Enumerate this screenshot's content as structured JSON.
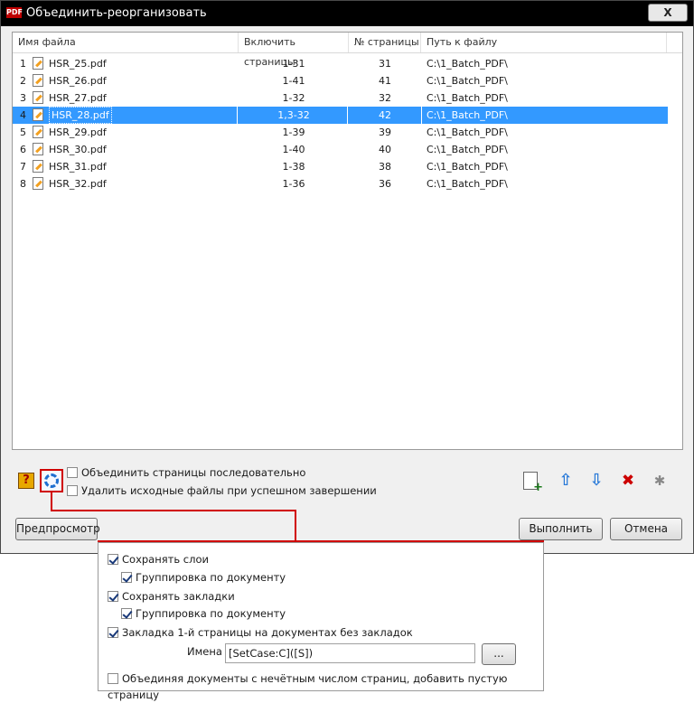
{
  "window": {
    "title": "Объединить-реорганизовать",
    "close_label": "X"
  },
  "columns": [
    "Имя файла",
    "Включить страницы",
    "№ страницы",
    "Путь к файлу"
  ],
  "rows": [
    {
      "num": "1",
      "name": "HSR_25.pdf",
      "include": "1-31",
      "pages": "31",
      "path": "C:\\1_Batch_PDF\\"
    },
    {
      "num": "2",
      "name": "HSR_26.pdf",
      "include": "1-41",
      "pages": "41",
      "path": "C:\\1_Batch_PDF\\"
    },
    {
      "num": "3",
      "name": "HSR_27.pdf",
      "include": "1-32",
      "pages": "32",
      "path": "C:\\1_Batch_PDF\\"
    },
    {
      "num": "4",
      "name": "HSR_28.pdf",
      "include": "1,3-32",
      "pages": "42",
      "path": "C:\\1_Batch_PDF\\",
      "selected": true
    },
    {
      "num": "5",
      "name": "HSR_29.pdf",
      "include": "1-39",
      "pages": "39",
      "path": "C:\\1_Batch_PDF\\"
    },
    {
      "num": "6",
      "name": "HSR_30.pdf",
      "include": "1-40",
      "pages": "40",
      "path": "C:\\1_Batch_PDF\\"
    },
    {
      "num": "7",
      "name": "HSR_31.pdf",
      "include": "1-38",
      "pages": "38",
      "path": "C:\\1_Batch_PDF\\"
    },
    {
      "num": "8",
      "name": "HSR_32.pdf",
      "include": "1-36",
      "pages": "36",
      "path": "C:\\1_Batch_PDF\\"
    }
  ],
  "options": {
    "merge_sequential": {
      "label": "Объединить страницы последовательно",
      "checked": false
    },
    "delete_sources": {
      "label": "Удалить исходные файлы при успешном завершении",
      "checked": false
    }
  },
  "buttons": {
    "preview": "Предпросмотр",
    "run": "Выполнить",
    "cancel": "Отмена",
    "browse": "..."
  },
  "toolbar_icons": [
    "help-icon",
    "settings-gear-icon",
    "new-document-icon",
    "move-up-icon",
    "move-down-icon",
    "delete-icon",
    "clean-icon"
  ],
  "popup": {
    "keep_layers": {
      "label": "Сохранять слои",
      "checked": true
    },
    "group_layers": {
      "label": "Группировка по документу",
      "checked": true
    },
    "keep_bookmarks": {
      "label": "Сохранять закладки",
      "checked": true
    },
    "group_bookmarks": {
      "label": "Группировка по документу",
      "checked": true
    },
    "first_page_bookmark": {
      "label": "Закладка 1-й страницы на документах без закладок",
      "checked": true
    },
    "names_label": "Имена",
    "names_value": "[SetCase:C]([S])",
    "odd_pages": {
      "label": "Объединяя документы с нечётным числом страниц, добавить пустую страницу",
      "checked": false
    }
  },
  "colors": {
    "titlebar": "#000000",
    "selection": "#3399ff",
    "highlight": "#d00000"
  }
}
